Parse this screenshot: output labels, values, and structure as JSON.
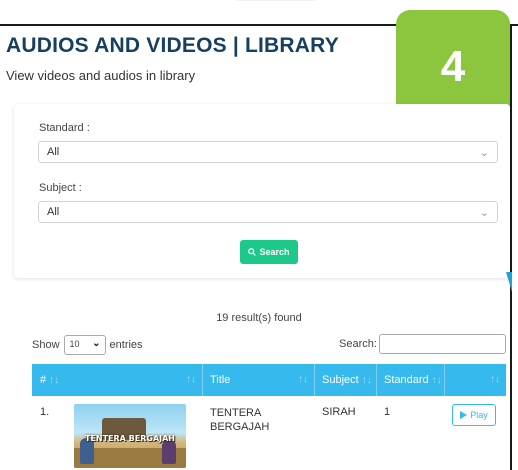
{
  "header": {
    "title": "AUDIOS AND VIDEOS | LIBRARY",
    "subtitle": "View videos and audios in library",
    "step_number": "4"
  },
  "filters": {
    "standard_label": "Standard :",
    "standard_value": "All",
    "subject_label": "Subject :",
    "subject_value": "All",
    "search_button": "Search"
  },
  "results": {
    "count_text": "19 result(s) found",
    "show_label": "Show",
    "entries_value": "10",
    "entries_label": "entries",
    "search_label": "Search:",
    "search_value": ""
  },
  "table": {
    "headers": [
      "#",
      "Title",
      "Subject",
      "Standard"
    ],
    "rows": [
      {
        "index": "1.",
        "thumbnail_text": "TENTERA BERGAJAH",
        "title_line1": "TENTERA",
        "title_line2": "BERGAJAH",
        "subject": "SIRAH",
        "standard": "1",
        "action": "Play"
      }
    ]
  },
  "colors": {
    "title": "#173f5f",
    "badge": "#8cc63f",
    "search_button": "#1cc88a",
    "table_header": "#36b9ec"
  },
  "icons": {
    "search_button_icon": "search-icon",
    "play_button_icon": "play-icon",
    "select_icon": "chevron-down-icon",
    "sort_icon": "sort-icon"
  }
}
